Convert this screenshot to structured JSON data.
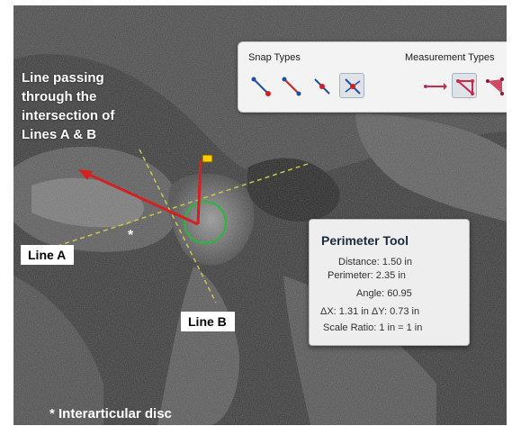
{
  "toolbar": {
    "snap_types_label": "Snap Types",
    "measurement_types_label": "Measurement Types",
    "snap_buttons": [
      {
        "icon": "snap-endpoint-icon",
        "selected": false
      },
      {
        "icon": "snap-midpoint-icon",
        "selected": false
      },
      {
        "icon": "snap-segment-icon",
        "selected": false
      },
      {
        "icon": "snap-intersection-icon",
        "selected": true
      }
    ],
    "measure_buttons": [
      {
        "icon": "distance-tool-icon",
        "selected": false
      },
      {
        "icon": "perimeter-tool-icon",
        "selected": true
      },
      {
        "icon": "area-tool-icon",
        "selected": false
      }
    ]
  },
  "tooltip": {
    "title": "Perimeter Tool",
    "distance": "Distance: 1.50 in",
    "perimeter": "Perimeter: 2.35 in",
    "angle": "Angle: 60.95",
    "delta": "ΔX: 1.31 in   ΔY: 0.73 in",
    "scale_ratio": "Scale Ratio: 1 in = 1 in"
  },
  "annotations": {
    "intersection_line_1": "Line passing",
    "intersection_line_2": "through the",
    "intersection_line_3": "intersection of",
    "intersection_line_4": "Lines A & B",
    "line_a": "Line A",
    "line_b": "Line B",
    "asterisk": "*",
    "footnote": "* Interarticular disc"
  },
  "colors": {
    "measure_red": "#d42020",
    "guide_yellow": "#c8c84a",
    "circle_green": "#27b83a",
    "highlight_oval": "#d01818",
    "tool_blue": "#1f4fa8"
  }
}
